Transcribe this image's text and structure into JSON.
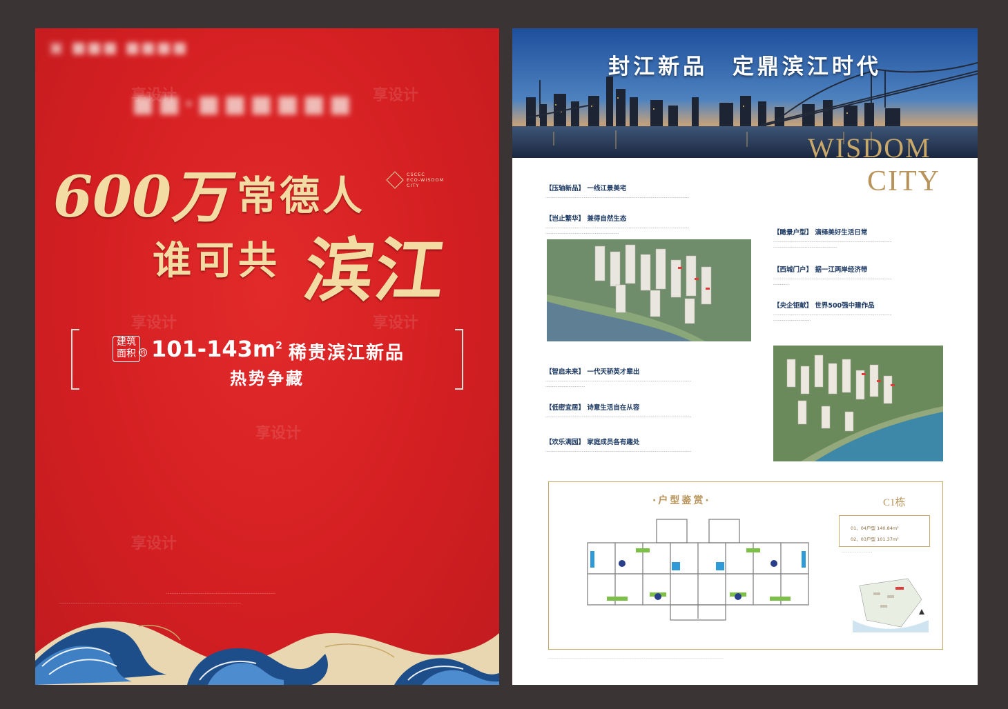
{
  "left": {
    "big_number": "600万",
    "line1": "常德人",
    "line2": "谁可共",
    "highlight": "滨江",
    "cscec": [
      "CSCEC",
      "ECO-WISDOM",
      "CITY"
    ],
    "area_tag": "建筑面积",
    "area_suffix": "约",
    "area_value": "101-143m",
    "area_sup": "2",
    "area_title": "稀贵滨江新品",
    "area_sub": "热势争藏"
  },
  "right": {
    "hero_title": "封江新品 定鼎滨江时代",
    "wisdom": "WISDOM",
    "city": "CITY",
    "sections": [
      {
        "tag": "【压轴新品】",
        "title": "一线江景美宅"
      },
      {
        "tag": "【岂止繁华】",
        "title": "兼得自然生态"
      },
      {
        "tag": "【瞰景户型】",
        "title": "演绎美好生活日常"
      },
      {
        "tag": "【西城门户】",
        "title": "据一江两岸经济带"
      },
      {
        "tag": "【央企钜献】",
        "title": "世界500强中建作品"
      },
      {
        "tag": "【智启未来】",
        "title": "一代天骄英才辈出"
      },
      {
        "tag": "【低密宜居】",
        "title": "诗意生活自在从容"
      },
      {
        "tag": "【欢乐满园】",
        "title": "家庭成员各有趣处"
      }
    ],
    "floorplan": {
      "title": "·户型鉴赏·",
      "building": "C1栋",
      "units": [
        "01、04户型 140.84m²",
        "02、03户型 101.37m²"
      ]
    }
  }
}
